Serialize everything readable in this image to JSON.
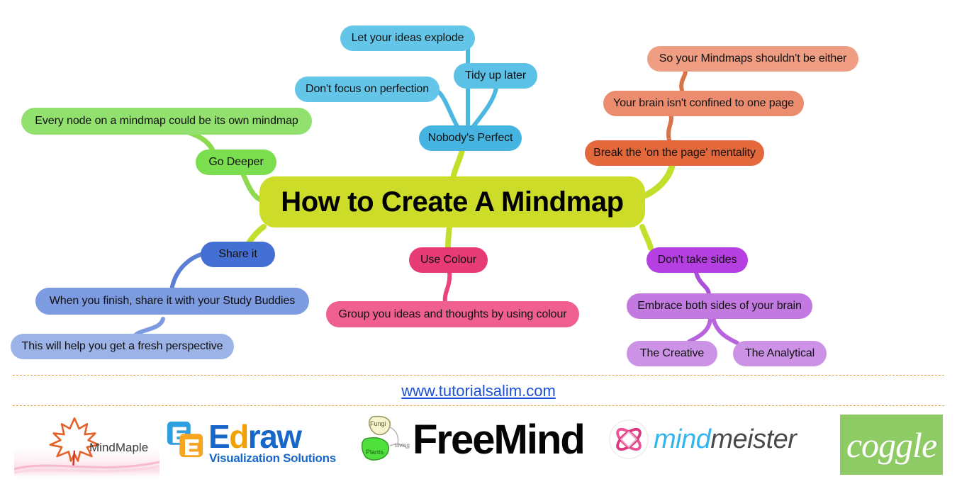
{
  "title": "How to Create A Mindmap",
  "mindmap": {
    "central": {
      "label": "How to Create A Mindmap",
      "color": "#cddc28",
      "text_color": "#000000"
    },
    "branches": [
      {
        "name": "go-deeper",
        "color": "#7ed957",
        "nodes": [
          {
            "label": "Every node on a mindmap could be its own mindmap",
            "color": "#92e06e"
          },
          {
            "label": "Go Deeper",
            "color": "#7ade4f"
          }
        ]
      },
      {
        "name": "nobodys-perfect",
        "color": "#4cb8e0",
        "nodes": [
          {
            "label": "Let your ideas explode",
            "color": "#63c5e8"
          },
          {
            "label": "Don't focus on perfection",
            "color": "#63c5e8"
          },
          {
            "label": "Tidy up later",
            "color": "#5bc1e6"
          },
          {
            "label": "Nobody's Perfect",
            "color": "#46b4e0"
          }
        ]
      },
      {
        "name": "break-the-page-mentality",
        "color": "#e06c3f",
        "nodes": [
          {
            "label": "So your Mindmaps shouldn't be either",
            "color": "#ef9d83"
          },
          {
            "label": "Your brain isn't confined to one page",
            "color": "#ec8c6e"
          },
          {
            "label": "Break the 'on the page' mentality",
            "color": "#e3683c"
          }
        ]
      },
      {
        "name": "share-it",
        "color": "#4a6fc9",
        "nodes": [
          {
            "label": "Share it",
            "color": "#4470d4"
          },
          {
            "label": "When you finish, share it with your Study Buddies",
            "color": "#7d9be0"
          },
          {
            "label": "This will help you get a fresh perspective",
            "color": "#9cb3e8"
          }
        ]
      },
      {
        "name": "use-colour",
        "color": "#e8447e",
        "nodes": [
          {
            "label": "Use Colour",
            "color": "#e63b74"
          },
          {
            "label": "Group you ideas and thoughts by using colour",
            "color": "#ef6090"
          }
        ]
      },
      {
        "name": "dont-take-sides",
        "color": "#a94fd8",
        "nodes": [
          {
            "label": "Don't take sides",
            "color": "#b council"
          },
          {
            "label": "Embrace both sides of your brain",
            "color": "#c27ae0"
          },
          {
            "label": "The Creative",
            "color": "#cb92e6"
          },
          {
            "label": "The Analytical",
            "color": "#cb92e6"
          }
        ]
      }
    ],
    "node_labels": {
      "let_ideas_explode": "Let your ideas explode",
      "dont_focus_perfection": "Don't focus on perfection",
      "tidy_up_later": "Tidy up later",
      "nobodys_perfect": "Nobody's Perfect",
      "so_your_mindmaps": "So your Mindmaps shouldn't be either",
      "brain_not_confined": "Your brain isn't confined to one page",
      "break_page_mentality": "Break the 'on the page' mentality",
      "every_node": "Every node on a mindmap could be its own mindmap",
      "go_deeper": "Go Deeper",
      "share_it": "Share it",
      "study_buddies": "When you finish, share it with your Study Buddies",
      "fresh_perspective": "This will help you get a fresh perspective",
      "use_colour": "Use Colour",
      "group_ideas": "Group you ideas and thoughts by using colour",
      "dont_take_sides": "Don't take sides",
      "embrace_both_sides": "Embrace both sides of your brain",
      "the_creative": "The Creative",
      "the_analytical": "The Analytical"
    }
  },
  "footer": {
    "site_url": "www.tutorialsalim.com",
    "link_color": "#1a4fd6",
    "rule_color": "#e8a33d",
    "logos": [
      {
        "name": "mindmaple",
        "word": "MindMaple"
      },
      {
        "name": "edraw",
        "word_1": "E",
        "word_d": "d",
        "word_2": "raw",
        "tagline": "Visualization Solutions"
      },
      {
        "name": "freemind",
        "word": "FreeMind",
        "icon_labels": [
          "Fungi",
          "Plants",
          "Living"
        ]
      },
      {
        "name": "mindmeister",
        "word_light": "mind",
        "word_dark": "meister"
      },
      {
        "name": "coggle",
        "word": "coggle",
        "background": "#8fcb65"
      }
    ]
  }
}
